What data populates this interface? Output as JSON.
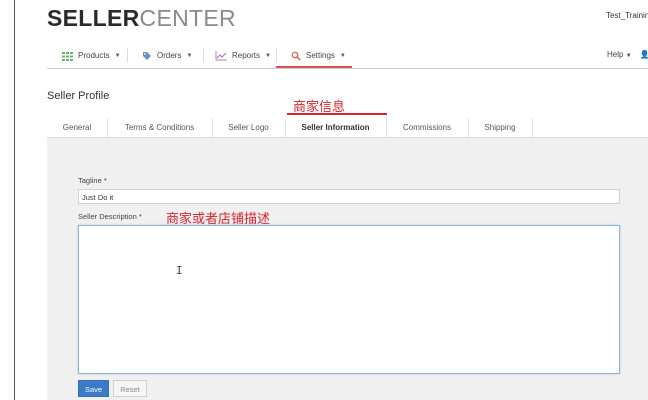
{
  "brand": {
    "bold": "SELLER",
    "light": "CENTER"
  },
  "user": {
    "name": "Test_Trainin"
  },
  "nav": {
    "items": [
      {
        "label": "Products",
        "icon": "grid-icon"
      },
      {
        "label": "Orders",
        "icon": "tag-icon"
      },
      {
        "label": "Reports",
        "icon": "chart-icon"
      },
      {
        "label": "Settings",
        "icon": "search-icon",
        "active": true
      }
    ],
    "help": "Help"
  },
  "page": {
    "title": "Seller Profile"
  },
  "tabs": [
    {
      "label": "General"
    },
    {
      "label": "Terms & Conditions"
    },
    {
      "label": "Seller Logo"
    },
    {
      "label": "Seller Information",
      "active": true
    },
    {
      "label": "Commissions"
    },
    {
      "label": "Shipping"
    }
  ],
  "annotations": {
    "tab": "商家信息",
    "description": "商家或者店铺描述"
  },
  "form": {
    "tagline_label": "Tagline *",
    "tagline_value": "Just Do it",
    "description_label": "Seller Description *",
    "description_value": "",
    "save": "Save",
    "reset": "Reset"
  },
  "colors": {
    "accent_red": "#d9534f",
    "annotation_red": "#d9232d",
    "primary_blue": "#3a7ac6",
    "panel_bg": "#f0f0f0"
  }
}
